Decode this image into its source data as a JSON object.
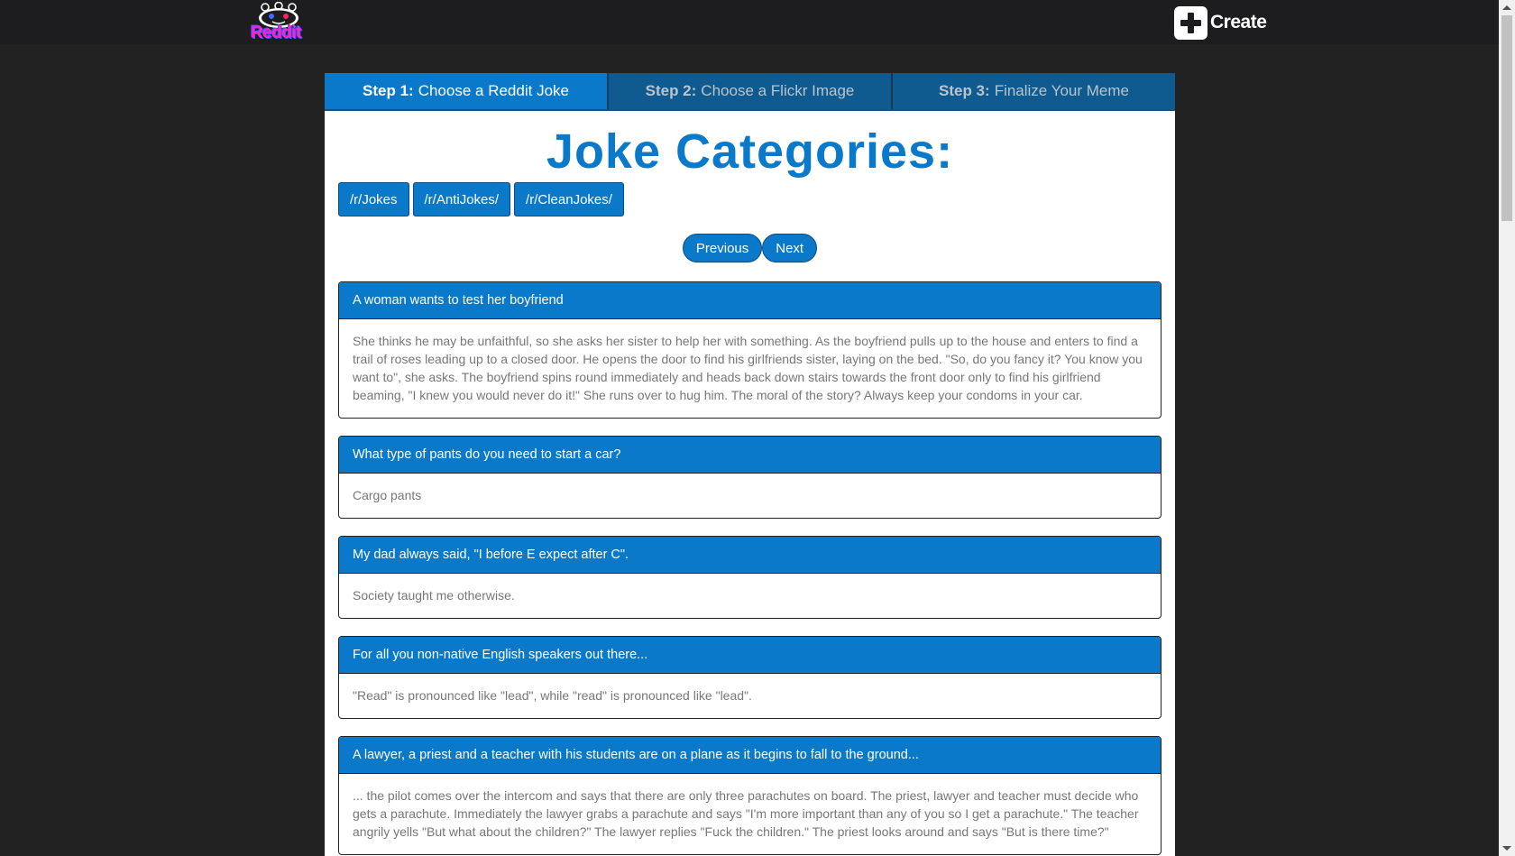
{
  "header": {
    "logo_text": "Reddit",
    "create_label": "Create"
  },
  "steps": [
    {
      "num": "Step 1:",
      "label": "Choose a Reddit Joke"
    },
    {
      "num": "Step 2:",
      "label": "Choose a Flickr Image"
    },
    {
      "num": "Step 3:",
      "label": "Finalize Your Meme"
    }
  ],
  "categories": {
    "title": "Joke Categories:",
    "items": [
      "/r/Jokes",
      "/r/AntiJokes/",
      "/r/CleanJokes/"
    ]
  },
  "pager": {
    "previous": "Previous",
    "next": "Next"
  },
  "jokes": [
    {
      "title": "A woman wants to test her boyfriend",
      "body": "She thinks he may be unfaithful, so she asks her sister to help her with something. As the boyfriend pulls up to the house and enters to find a trail of roses leading up to a closed door. He opens the door to find his girlfriends sister, laying on the bed. \"So, do you fancy it? You know you want to\", she asks. The boyfriend spins round immediately and heads back down stairs towards the front door only to find his girlfriend beaming, \"I knew you would never do it!\" She runs over to hug him. The moral of the story? Always keep your condoms in your car."
    },
    {
      "title": "What type of pants do you need to start a car?",
      "body": "Cargo pants"
    },
    {
      "title": "My dad always said, \"I before E expect after C\".",
      "body": "Society taught me otherwise."
    },
    {
      "title": "For all you non-native English speakers out there...",
      "body": "\"Read\" is pronounced like \"lead\", while \"read\" is pronounced like \"lead\"."
    },
    {
      "title": "A lawyer, a priest and a teacher with his students are on a plane as it begins to fall to the ground...",
      "body": "... the pilot comes over the intercom and says that there are only three parachutes on board. The priest, lawyer and teacher must decide who gets a parachute. Immediately the lawyer grabs a parachute and says \"I'm more important than any of you so I get a parachute.\" The teacher angrily yells \"But what about the children?\" The lawyer replies \"Fuck the children.\" The priest looks around and says \"But is there time?\""
    }
  ],
  "colors": {
    "accent": "#0a79c9",
    "background": "#222222",
    "topbar": "#1d1d1f"
  }
}
